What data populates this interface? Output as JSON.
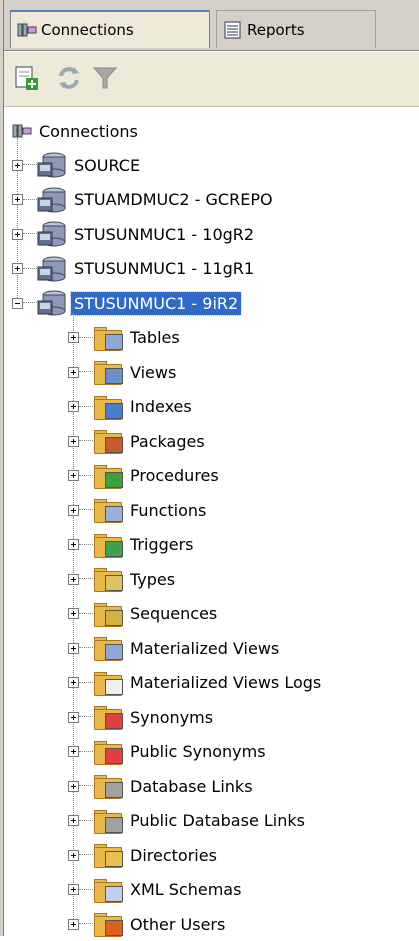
{
  "tabs": [
    {
      "label": "Connections",
      "icon": "connections-icon",
      "active": true
    },
    {
      "label": "Reports",
      "icon": "reports-icon",
      "active": false
    }
  ],
  "toolbar": {
    "buttons": [
      {
        "name": "new-connection-button",
        "icon": "new-connection-icon"
      },
      {
        "name": "refresh-button",
        "icon": "refresh-icon"
      },
      {
        "name": "filter-button",
        "icon": "filter-icon"
      }
    ]
  },
  "tree": {
    "root_label": "Connections",
    "connections": [
      {
        "label": "SOURCE",
        "expanded": false
      },
      {
        "label": "STUAMDMUC2 - GCREPO",
        "expanded": false
      },
      {
        "label": "STUSUNMUC1 - 10gR2",
        "expanded": false
      },
      {
        "label": "STUSUNMUC1 - 11gR1",
        "expanded": false
      },
      {
        "label": "STUSUNMUC1 - 9iR2",
        "expanded": true,
        "selected": true
      }
    ],
    "children": [
      {
        "label": "Tables",
        "icon": "tables-icon",
        "badge": "#8fa8d8"
      },
      {
        "label": "Views",
        "icon": "views-icon",
        "badge": "#6f8fc8"
      },
      {
        "label": "Indexes",
        "icon": "indexes-icon",
        "badge": "#4a7cd0"
      },
      {
        "label": "Packages",
        "icon": "packages-icon",
        "badge": "#c85a30"
      },
      {
        "label": "Procedures",
        "icon": "procedures-icon",
        "badge": "#3aa040"
      },
      {
        "label": "Functions",
        "icon": "functions-icon",
        "badge": "#9ab0d8"
      },
      {
        "label": "Triggers",
        "icon": "triggers-icon",
        "badge": "#40a050"
      },
      {
        "label": "Types",
        "icon": "types-icon",
        "badge": "#e0c060"
      },
      {
        "label": "Sequences",
        "icon": "sequences-icon",
        "badge": "#d8b040"
      },
      {
        "label": "Materialized Views",
        "icon": "materialized-views-icon",
        "badge": "#8fa8d8"
      },
      {
        "label": "Materialized Views Logs",
        "icon": "materialized-views-logs-icon",
        "badge": "#f0f0f0"
      },
      {
        "label": "Synonyms",
        "icon": "synonyms-icon",
        "badge": "#e04040"
      },
      {
        "label": "Public Synonyms",
        "icon": "public-synonyms-icon",
        "badge": "#e04040"
      },
      {
        "label": "Database Links",
        "icon": "database-links-icon",
        "badge": "#a0a0a0"
      },
      {
        "label": "Public Database Links",
        "icon": "public-database-links-icon",
        "badge": "#a0a0a0"
      },
      {
        "label": "Directories",
        "icon": "directories-icon",
        "badge": "#e8c050"
      },
      {
        "label": "XML Schemas",
        "icon": "xml-schemas-icon",
        "badge": "#c0d0f0"
      },
      {
        "label": "Other Users",
        "icon": "other-users-icon",
        "badge": "#e06020"
      }
    ]
  },
  "colors": {
    "selection": "#3169c6",
    "folder": "#e8b84a",
    "tab_bar": "#d4d0c8",
    "toolbar": "#ece9d8"
  }
}
